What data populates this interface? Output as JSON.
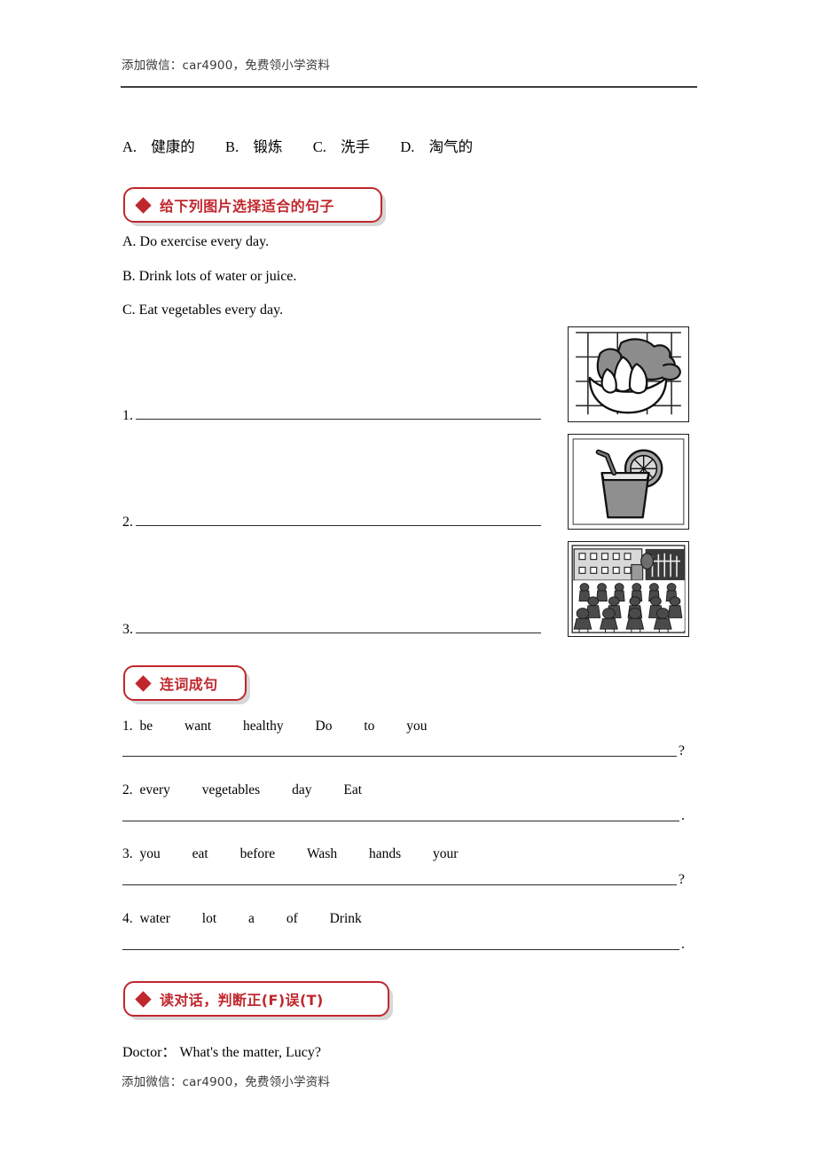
{
  "watermark": {
    "top": "添加微信：car4900，免费领小学资料",
    "bottom": "添加微信：car4900，免费领小学资料"
  },
  "colors": {
    "accent": "#c0272d",
    "text": "#000000",
    "rule": "#2b2b2b"
  },
  "vocab_options": {
    "a_letter": "A.",
    "a_text": "健康的",
    "b_letter": "B.",
    "b_text": "锻炼",
    "c_letter": "C.",
    "c_text": "洗手",
    "d_letter": "D.",
    "d_text": "淘气的"
  },
  "sections": [
    {
      "bullet": "diamond",
      "title": "给下列图片选择适合的句子"
    },
    {
      "bullet": "diamond",
      "title": "连词成句"
    },
    {
      "bullet": "diamond",
      "title": "读对话，判断正(F)误(T)"
    }
  ],
  "picture_matching": {
    "choices": [
      "A. Do exercise every day.",
      "B. Drink lots of water or juice.",
      "C. Eat vegetables every day."
    ],
    "blanks": [
      {
        "number": "1."
      },
      {
        "number": "2."
      },
      {
        "number": "3."
      }
    ],
    "pictures": [
      {
        "name": "vegetables-bowl-image",
        "alt": "bowl of leafy vegetables"
      },
      {
        "name": "juice-glass-image",
        "alt": "glass of juice with straw and lemon slice"
      },
      {
        "name": "students-exercising-image",
        "alt": "students doing exercise in schoolyard"
      }
    ]
  },
  "word_order": {
    "items": [
      {
        "number": "1.",
        "words": [
          "be",
          "want",
          "healthy",
          "Do",
          "to",
          "you"
        ],
        "end_punct": "?"
      },
      {
        "number": "2.",
        "words": [
          "every",
          "vegetables",
          "day",
          "Eat"
        ],
        "end_punct": "."
      },
      {
        "number": "3.",
        "words": [
          "you",
          "eat",
          "before",
          "Wash",
          "hands",
          "your"
        ],
        "end_punct": "?"
      },
      {
        "number": "4.",
        "words": [
          "water",
          "lot",
          "a",
          "of",
          "Drink"
        ],
        "end_punct": "."
      }
    ]
  },
  "dialogue": {
    "lines": [
      {
        "speaker": "Doctor：",
        "text": "What's the matter, Lucy?"
      }
    ]
  }
}
